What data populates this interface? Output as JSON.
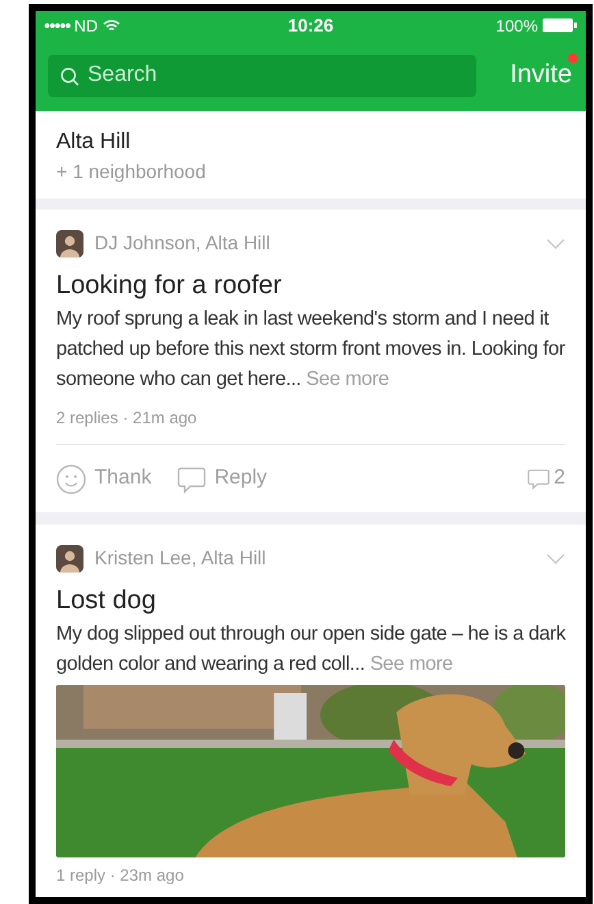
{
  "status_bar": {
    "signal": "●●●●●",
    "carrier": "ND",
    "time": "10:26",
    "battery": "100%"
  },
  "nav": {
    "search": {
      "placeholder": "Search"
    },
    "invite": "Invite",
    "has_notification": true
  },
  "neighborhood": {
    "name": "Alta Hill",
    "subtitle": "+ 1 neighborhood"
  },
  "posts": [
    {
      "kind": "text",
      "author": "DJ Johnson, Alta Hill",
      "title": "Looking for a roofer",
      "body": "My roof sprung a leak in last weekend's storm and I need it patched up before this next storm front moves in. Looking for someone who can get here...",
      "see_more": "See more",
      "meta": "2 replies · 21m ago",
      "actions": {
        "thank": "Thank",
        "reply": "Reply",
        "comments": "2"
      }
    },
    {
      "author": "Kristen Lee, Alta Hill",
      "title": "Lost dog",
      "body": "My dog slipped out through our open side gate – he is a dark golden color and wearing a red coll...",
      "see_more": "See more",
      "meta": "1 reply · 23m ago"
    }
  ]
}
